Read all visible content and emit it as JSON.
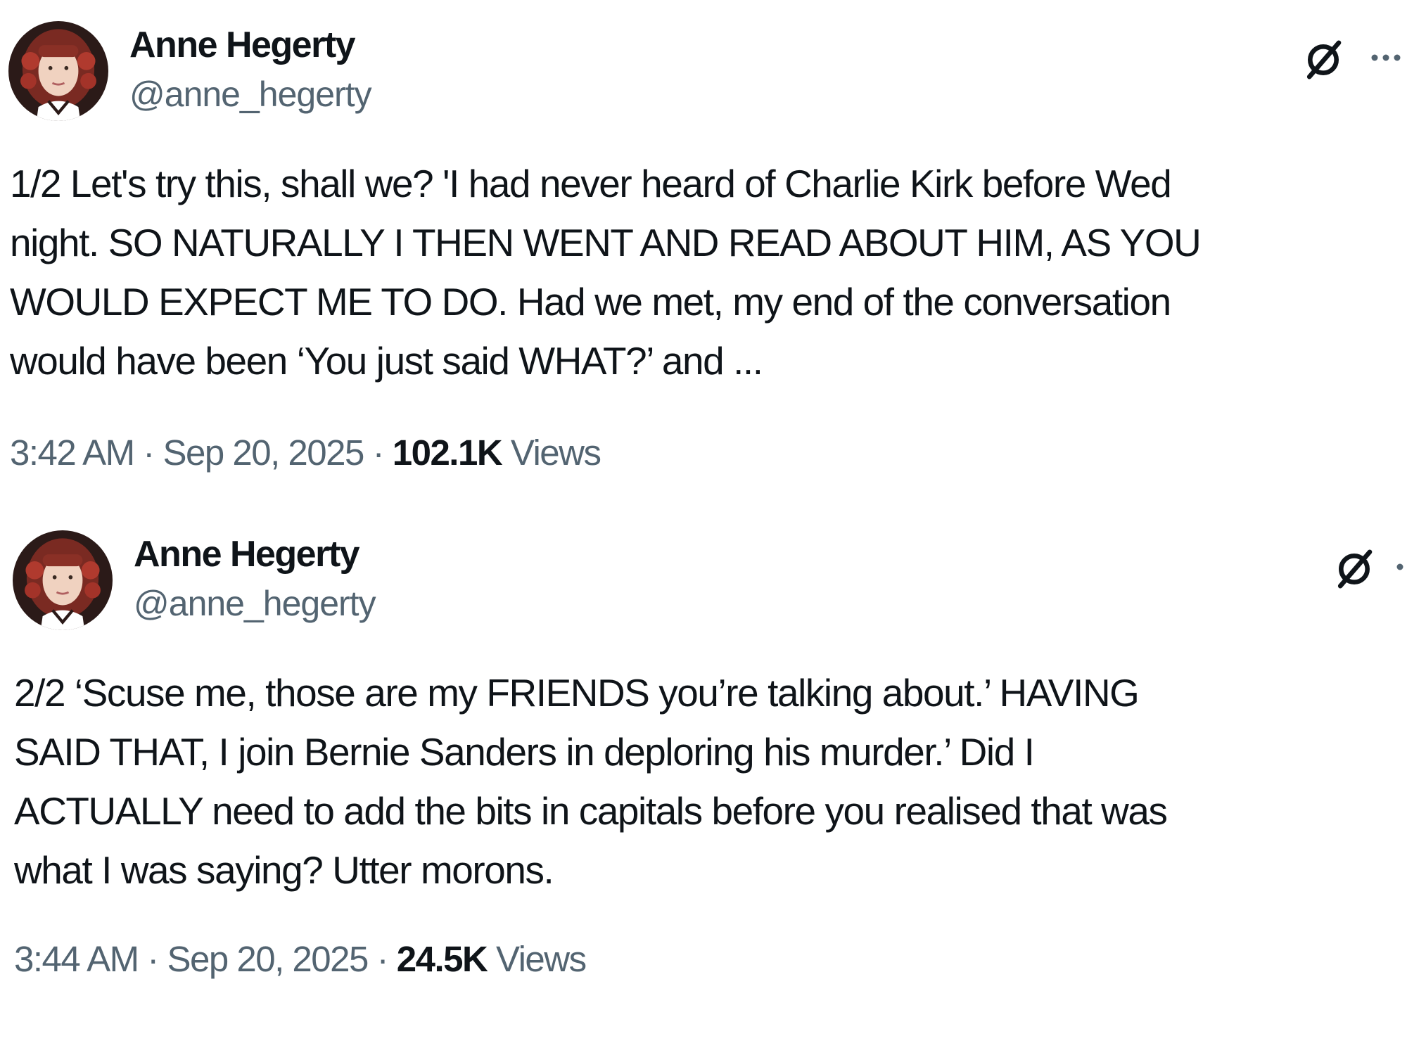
{
  "colors": {
    "text_primary": "#0f1419",
    "text_secondary": "#536471",
    "background": "#ffffff"
  },
  "tweets": [
    {
      "display_name": "Anne Hegerty",
      "handle": "@anne_hegerty",
      "avatar_icon": "profile-photo",
      "actions": [
        "grok-icon",
        "more-icon"
      ],
      "more_label": "···",
      "text_lines": [
        "1/2 Let's try this, shall we? 'I had never heard of Charlie Kirk before Wed",
        "night. SO NATURALLY I THEN WENT AND READ ABOUT HIM, AS YOU",
        "WOULD EXPECT ME TO DO. Had we met, my end of the conversation",
        "would have been ‘You just said WHAT?’ and ..."
      ],
      "time": "3:42 AM",
      "separator": "·",
      "date": "Sep 20, 2025",
      "views_count": "102.1K",
      "views_label": "Views"
    },
    {
      "display_name": "Anne Hegerty",
      "handle": "@anne_hegerty",
      "avatar_icon": "profile-photo",
      "actions": [
        "grok-icon",
        "more-icon"
      ],
      "more_label": "···",
      "text_lines": [
        "2/2 ‘Scuse me, those are my FRIENDS you’re talking about.’ HAVING",
        "SAID THAT, I join Bernie Sanders in deploring his murder.’ Did I",
        "ACTUALLY need to add the bits in capitals before you realised that was",
        "what I was saying? Utter morons."
      ],
      "time": "3:44 AM",
      "separator": "·",
      "date": "Sep 20, 2025",
      "views_count": "24.5K",
      "views_label": "Views"
    }
  ]
}
